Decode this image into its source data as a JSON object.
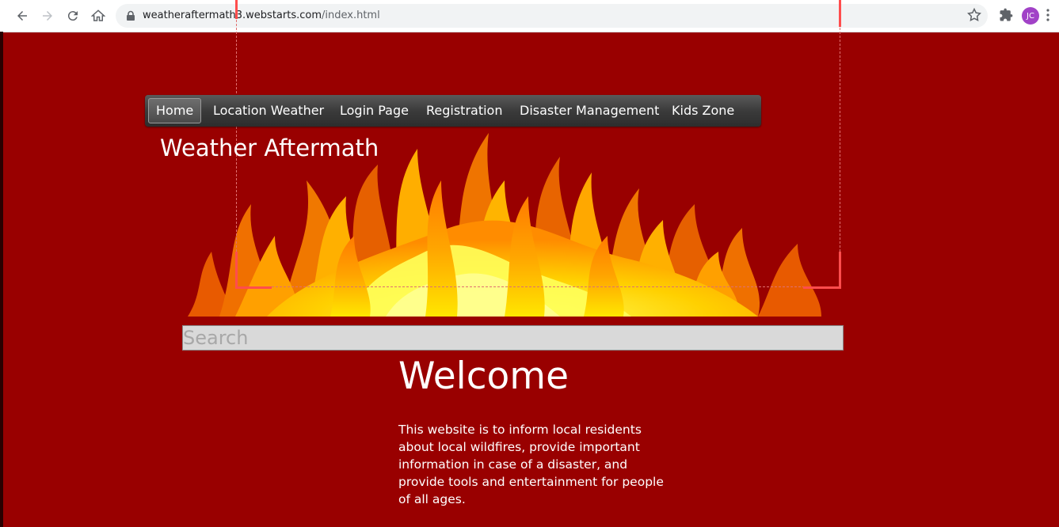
{
  "browser": {
    "url_host": "weatheraftermath3.webstarts.com",
    "url_path": "/index.html",
    "profile_initials": "JC",
    "icons": [
      "back-icon",
      "forward-icon",
      "reload-icon",
      "home-icon",
      "lock-icon",
      "star-icon",
      "extensions-icon",
      "menu-icon"
    ]
  },
  "nav": {
    "items": [
      {
        "label": "Home"
      },
      {
        "label": "Location Weather"
      },
      {
        "label": "Login Page"
      },
      {
        "label": "Registration"
      },
      {
        "label": "Disaster Management"
      },
      {
        "label": "Kids Zone"
      }
    ],
    "active_index": 0
  },
  "site": {
    "title": "Weather Aftermath"
  },
  "search": {
    "placeholder": "Search"
  },
  "main": {
    "heading": "Welcome",
    "intro": "This website is to inform local residents about local wildfires, provide important information in case of a disaster, and provide tools and entertainment for people of all ages."
  },
  "colors": {
    "page_background": "#990000",
    "flame_dark": "#e25a00",
    "flame_mid": "#ff9900",
    "flame_light": "#ffd500",
    "flame_core": "#ffff66"
  }
}
